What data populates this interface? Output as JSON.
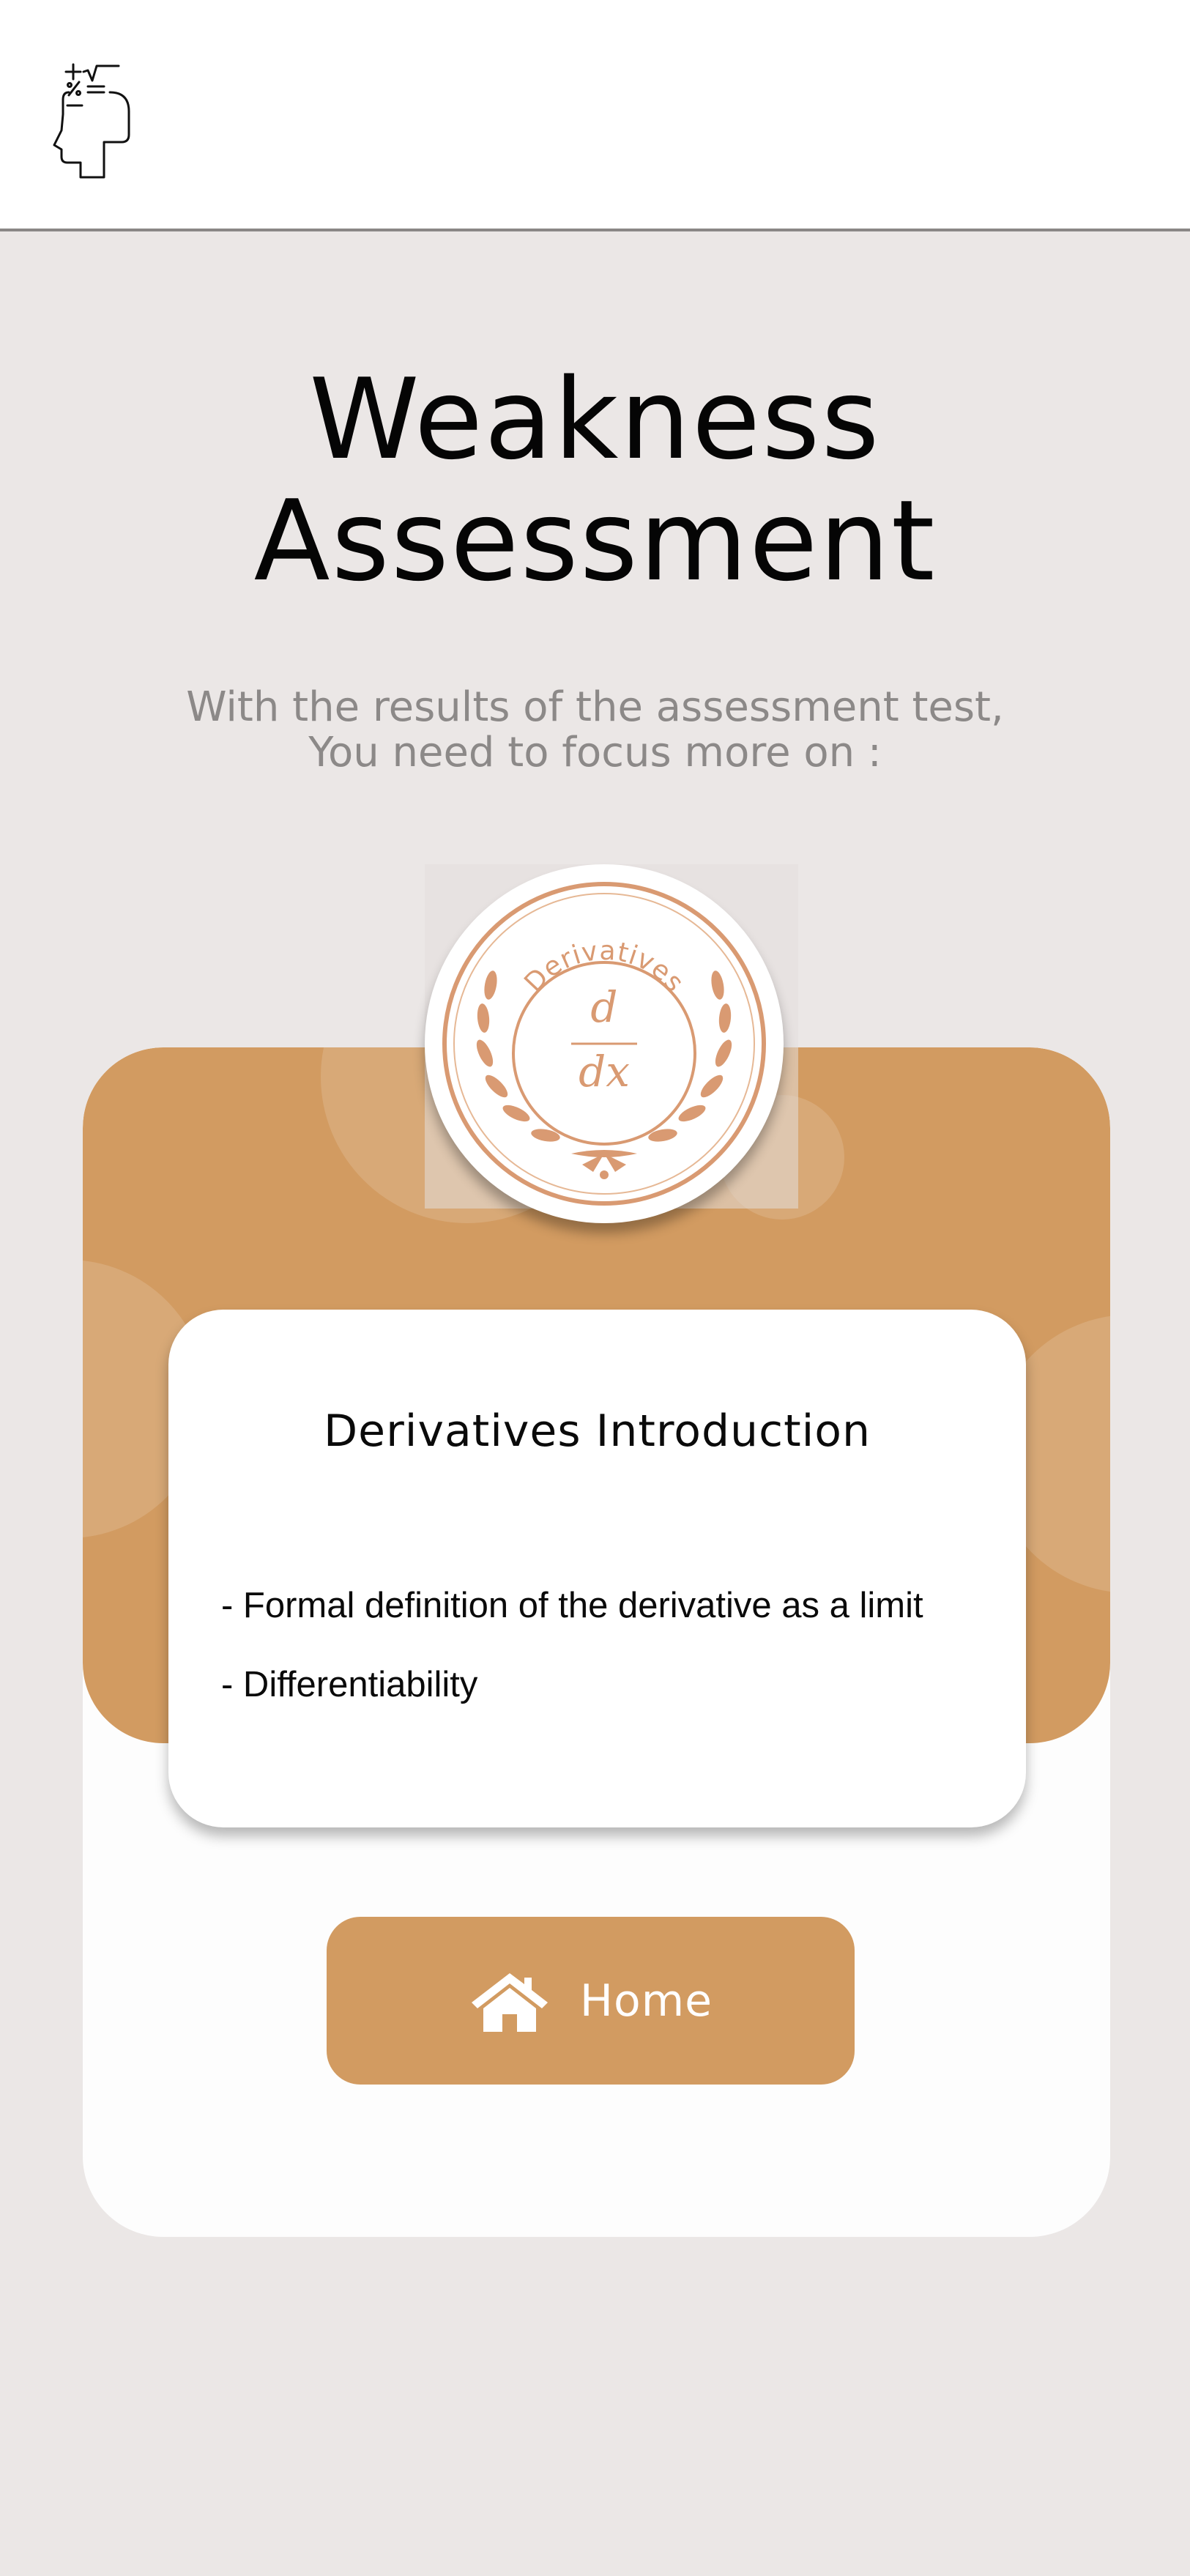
{
  "header": {
    "logo_icon": "math-head-icon"
  },
  "title": {
    "line1": "Weakness",
    "line2": "Assessment"
  },
  "subtitle": {
    "line1": "With the results of the assessment test,",
    "line2": "You need to focus more on :"
  },
  "badge": {
    "label": "Derivatives",
    "numerator": "d",
    "denominator": "dx",
    "icon": "laurel-wreath-icon"
  },
  "weakness_card": {
    "title": "Derivatives Introduction",
    "topics": [
      "- Formal definition of the derivative as a limit",
      "- Differentiability"
    ]
  },
  "home_button": {
    "label": "Home",
    "icon": "home-icon"
  },
  "colors": {
    "accent": "#d29b61",
    "background": "#ebe7e6",
    "badge_ink": "#d99a72",
    "subtitle_text": "#8c8988"
  }
}
